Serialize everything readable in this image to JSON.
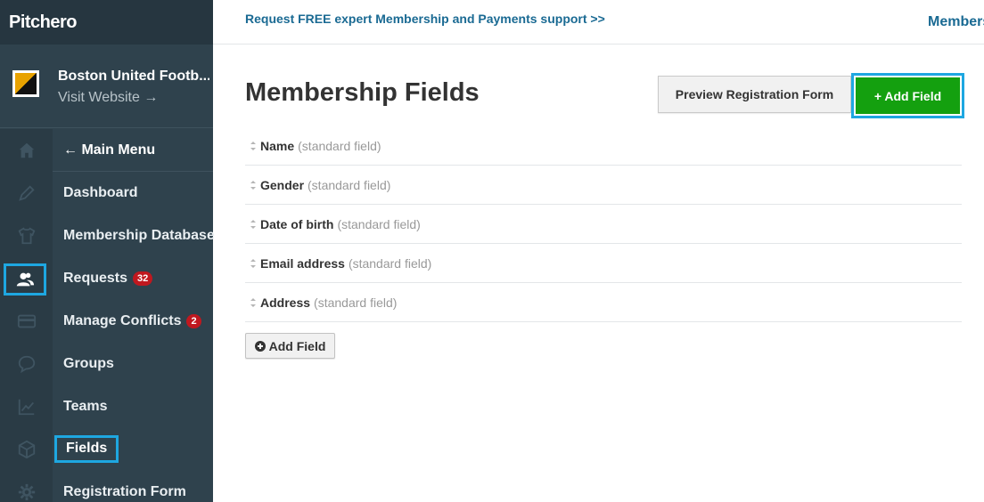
{
  "brand": {
    "logo": "Pitchero"
  },
  "club": {
    "name": "Boston United Footb...",
    "visit_label": "Visit Website →"
  },
  "rail_icons": [
    "home-icon",
    "pencil-icon",
    "shirt-icon",
    "members-icon",
    "card-icon",
    "chat-icon",
    "chart-icon",
    "cube-icon",
    "gear-icon"
  ],
  "menu": {
    "back_label": "← Main Menu",
    "items": [
      {
        "label": "Dashboard",
        "badge": ""
      },
      {
        "label": "Membership Database",
        "badge": ""
      },
      {
        "label": "Requests",
        "badge": "32"
      },
      {
        "label": "Manage Conflicts",
        "badge": "2"
      },
      {
        "label": "Groups",
        "badge": ""
      },
      {
        "label": "Teams",
        "badge": ""
      },
      {
        "label": "Fields",
        "badge": ""
      },
      {
        "label": "Registration Form",
        "badge": ""
      }
    ]
  },
  "topbar": {
    "promo": "Request FREE expert Membership and Payments support >>",
    "right_label": "Members"
  },
  "main": {
    "title": "Membership Fields",
    "preview_button": "Preview Registration Form",
    "add_field_button": "+ Add Field",
    "add_field_small": "Add Field",
    "fields": [
      {
        "name": "Name",
        "note": "(standard field)"
      },
      {
        "name": "Gender",
        "note": "(standard field)"
      },
      {
        "name": "Date of birth",
        "note": "(standard field)"
      },
      {
        "name": "Email address",
        "note": "(standard field)"
      },
      {
        "name": "Address",
        "note": "(standard field)"
      }
    ]
  },
  "colors": {
    "sidebar": "#2f424d",
    "accent_highlight": "#1ea7e1",
    "primary_button": "#14a00f",
    "link": "#1a6a93",
    "badge": "#c0181f"
  }
}
